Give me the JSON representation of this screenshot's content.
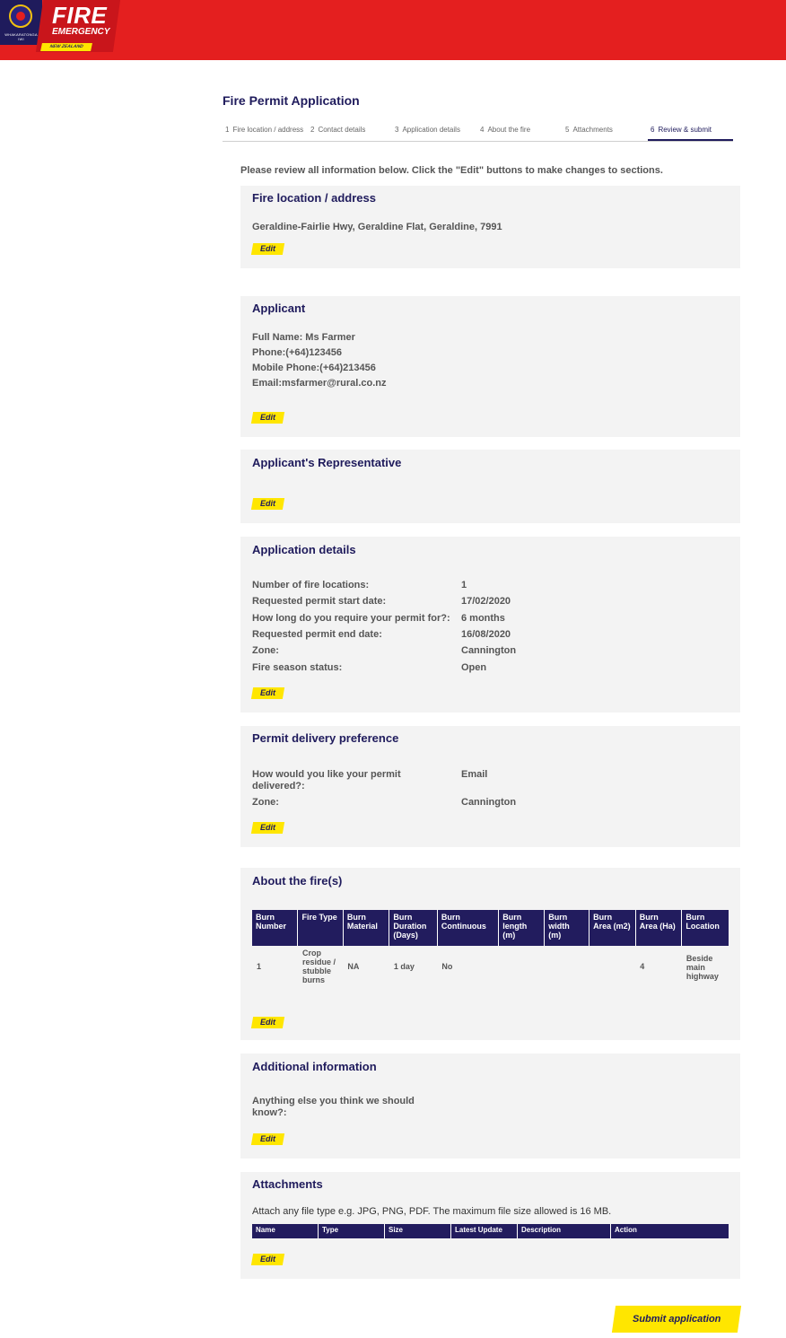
{
  "header": {
    "crest_text": "WHAKARATONGA IWI",
    "brand_line1": "FIRE",
    "brand_line2": "EMERGENCY",
    "brand_line3": "NEW ZEALAND",
    "colors": {
      "red": "#e41f1f",
      "navy": "#1f1b5c",
      "yellow": "#ffe600"
    }
  },
  "page_title": "Fire Permit Application",
  "steps": [
    {
      "num": "1",
      "label": "Fire location / address"
    },
    {
      "num": "2",
      "label": "Contact details"
    },
    {
      "num": "3",
      "label": "Application details"
    },
    {
      "num": "4",
      "label": "About the fire"
    },
    {
      "num": "5",
      "label": "Attachments"
    },
    {
      "num": "6",
      "label": "Review & submit",
      "active": true
    }
  ],
  "intro": "Please review all information below. Click the \"Edit\" buttons to make changes to sections.",
  "edit_label": "Edit",
  "fire_location": {
    "title": "Fire location / address",
    "address": "Geraldine-Fairlie Hwy, Geraldine Flat, Geraldine, 7991"
  },
  "applicant": {
    "title": "Applicant",
    "full_name": "Full Name: Ms Farmer",
    "phone": "Phone:(+64)123456",
    "mobile": "Mobile Phone:(+64)213456",
    "email": "Email:msfarmer@rural.co.nz"
  },
  "representative": {
    "title": "Applicant's Representative"
  },
  "application_details": {
    "title": "Application details",
    "rows": [
      {
        "label": "Number of fire locations:",
        "value": "1"
      },
      {
        "label": "Requested permit start date:",
        "value": "17/02/2020"
      },
      {
        "label": "How long do you require your permit for?:",
        "value": "6 months"
      },
      {
        "label": "Requested permit end date:",
        "value": "16/08/2020"
      },
      {
        "label": "Zone:",
        "value": "Cannington"
      },
      {
        "label": "Fire season status:",
        "value": "Open"
      }
    ]
  },
  "delivery": {
    "title": "Permit delivery preference",
    "q_line1": "How would you like your permit",
    "q_line2": "delivered?:",
    "q_value": "Email",
    "zone_label": "Zone:",
    "zone_value": "Cannington"
  },
  "about_fire": {
    "title": "About the fire(s)",
    "headers": [
      [
        "Burn",
        "Number"
      ],
      [
        "Fire Type"
      ],
      [
        "Burn",
        "Material"
      ],
      [
        "Burn",
        "Duration",
        "(Days)"
      ],
      [
        "Burn",
        "Continuous"
      ],
      [
        "Burn",
        "length",
        "(m)"
      ],
      [
        "Burn",
        "width",
        "(m)"
      ],
      [
        "Burn",
        "Area (m2)"
      ],
      [
        "Burn",
        "Area (Ha)"
      ],
      [
        "Burn",
        "Location"
      ]
    ],
    "rows": [
      [
        [
          "1"
        ],
        [
          "Crop",
          "residue /",
          "stubble",
          "burns"
        ],
        [
          "NA"
        ],
        [
          "1 day"
        ],
        [
          "No"
        ],
        [
          ""
        ],
        [
          ""
        ],
        [
          ""
        ],
        [
          "4"
        ],
        [
          "Beside",
          "main",
          "highway"
        ]
      ]
    ]
  },
  "additional": {
    "title": "Additional information",
    "q_line1": "Anything else you think we should",
    "q_line2": "know?:"
  },
  "attachments": {
    "title": "Attachments",
    "note": "Attach any file type e.g. JPG, PNG, PDF. The maximum file size allowed is 16 MB.",
    "headers": [
      "Name",
      "Type",
      "Size",
      "Latest Update",
      "Description",
      "Action"
    ]
  },
  "submit_label": "Submit application"
}
